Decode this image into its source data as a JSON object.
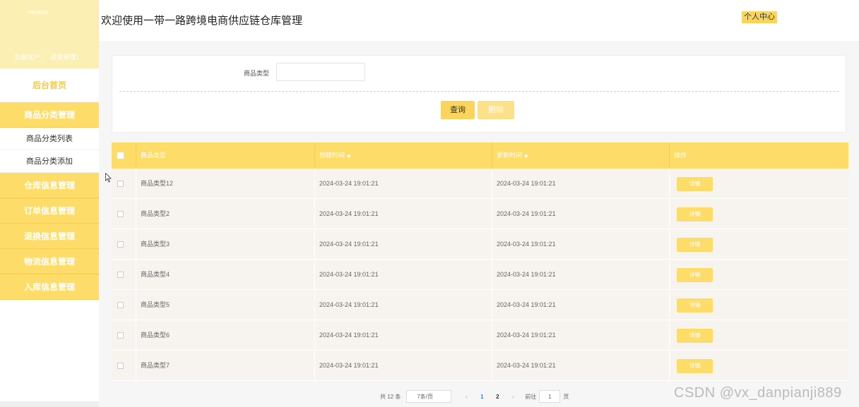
{
  "sidebar": {
    "avatar_text": "•avatar",
    "user_label": "当前用户：",
    "user_name": "超级管理1",
    "home": "后台首页",
    "groups": [
      {
        "label": "商品分类管理",
        "items": [
          "商品分类列表",
          "商品分类添加"
        ]
      },
      {
        "label": "仓库信息管理"
      },
      {
        "label": "订单信息管理"
      },
      {
        "label": "退换信息管理"
      },
      {
        "label": "物流信息管理"
      },
      {
        "label": "入库信息管理"
      }
    ]
  },
  "header": {
    "title": "欢迎使用一带一路跨境电商供应链仓库管理",
    "user_center": "个人中心"
  },
  "search": {
    "label": "商品类型",
    "value": "",
    "query_button": "查询",
    "delete_button": "删除"
  },
  "table": {
    "columns": [
      "商品类型",
      "创建时间",
      "更新时间",
      "操作"
    ],
    "rows": [
      {
        "type": "商品类型12",
        "created": "2024-03-24 19:01:21",
        "updated": "2024-03-24 19:01:21",
        "action": "详情"
      },
      {
        "type": "商品类型2",
        "created": "2024-03-24 19:01:21",
        "updated": "2024-03-24 19:01:21",
        "action": "详情"
      },
      {
        "type": "商品类型3",
        "created": "2024-03-24 19:01:21",
        "updated": "2024-03-24 19:01:21",
        "action": "详情"
      },
      {
        "type": "商品类型4",
        "created": "2024-03-24 19:01:21",
        "updated": "2024-03-24 19:01:21",
        "action": "详情"
      },
      {
        "type": "商品类型5",
        "created": "2024-03-24 19:01:21",
        "updated": "2024-03-24 19:01:21",
        "action": "详情"
      },
      {
        "type": "商品类型6",
        "created": "2024-03-24 19:01:21",
        "updated": "2024-03-24 19:01:21",
        "action": "详情"
      },
      {
        "type": "商品类型7",
        "created": "2024-03-24 19:01:21",
        "updated": "2024-03-24 19:01:21",
        "action": "详情"
      }
    ]
  },
  "pagination": {
    "total": "共 12 条",
    "page_size": "7条/页",
    "prev": "‹",
    "pages": [
      "1",
      "2"
    ],
    "current": "1",
    "next": "›",
    "goto_label": "前往",
    "goto_value": "1",
    "goto_suffix": "页"
  },
  "watermark": "CSDN @vx_danpianji889",
  "colors": {
    "accent": "#fedc6a",
    "sidebar_head": "#fcefb4",
    "row_bg": "#f7f3ef"
  }
}
